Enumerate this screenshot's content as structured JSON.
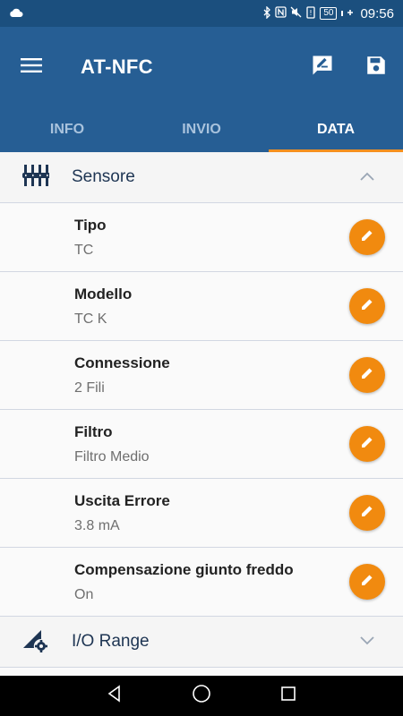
{
  "status_bar": {
    "battery": "50",
    "time": "09:56"
  },
  "app_bar": {
    "title": "AT-NFC"
  },
  "tabs": [
    {
      "label": "INFO",
      "active": false
    },
    {
      "label": "INVIO",
      "active": false
    },
    {
      "label": "DATA",
      "active": true
    }
  ],
  "sections": [
    {
      "title": "Sensore",
      "icon": "sliders-icon",
      "expanded": true,
      "rows": [
        {
          "label": "Tipo",
          "value": "TC"
        },
        {
          "label": "Modello",
          "value": "TC K"
        },
        {
          "label": "Connessione",
          "value": "2 Fili"
        },
        {
          "label": "Filtro",
          "value": "Filtro Medio"
        },
        {
          "label": "Uscita Errore",
          "value": "3.8 mA"
        },
        {
          "label": "Compensazione giunto freddo",
          "value": "On"
        }
      ]
    },
    {
      "title": "I/O Range",
      "icon": "signal-settings-icon",
      "expanded": false
    }
  ],
  "colors": {
    "status_bar": "#1b4f7e",
    "app_bar": "#265e94",
    "accent": "#f18a0f",
    "tab_indicator": "#f5901f"
  }
}
